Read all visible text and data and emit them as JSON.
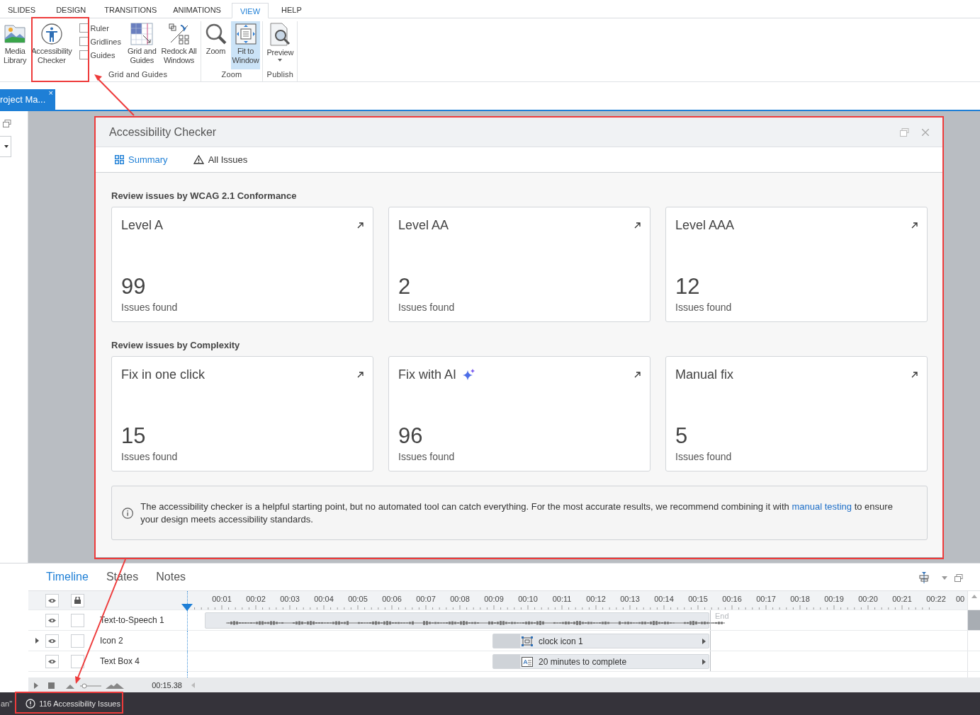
{
  "ribbon_tabs": [
    {
      "label": "SLIDES",
      "selected": false
    },
    {
      "label": "DESIGN",
      "selected": false
    },
    {
      "label": "TRANSITIONS",
      "selected": false
    },
    {
      "label": "ANIMATIONS",
      "selected": false
    },
    {
      "label": "VIEW",
      "selected": true
    },
    {
      "label": "HELP",
      "selected": false
    }
  ],
  "ribbon_groups": [
    {
      "items": [
        {
          "kind": "button",
          "label": "Media\nLibrary",
          "selected": false
        },
        {
          "kind": "button",
          "label": "Accessibility\nChecker",
          "selected": false
        }
      ]
    },
    {
      "label": "Grid and Guides",
      "items": [
        {
          "kind": "checks",
          "options": [
            {
              "label": "Ruler",
              "checked": false
            },
            {
              "label": "Gridlines",
              "checked": false
            },
            {
              "label": "Guides",
              "checked": false
            }
          ]
        },
        {
          "kind": "button",
          "label": "Grid and\nGuides",
          "selected": false
        },
        {
          "kind": "button",
          "label": "Redock All\nWindows",
          "selected": false
        }
      ]
    },
    {
      "label": "Zoom",
      "items": [
        {
          "kind": "button",
          "label": "Zoom",
          "selected": false
        },
        {
          "kind": "button",
          "label": "Fit to\nWindow",
          "selected": true
        }
      ]
    },
    {
      "label": "Publish",
      "items": [
        {
          "kind": "dropdown",
          "label": "Preview",
          "selected": false
        }
      ]
    }
  ],
  "document_tab": {
    "label": "roject Ma...",
    "close": "×"
  },
  "dialog": {
    "title": "Accessibility Checker",
    "tabs": [
      {
        "label": "Summary",
        "selected": true
      },
      {
        "label": "All Issues",
        "selected": false
      }
    ],
    "sections": [
      {
        "heading": "Review issues by WCAG 2.1 Conformance",
        "cards": [
          {
            "title": "Level A",
            "count": "99",
            "caption": "Issues found",
            "sparkle": false
          },
          {
            "title": "Level AA",
            "count": "2",
            "caption": "Issues found",
            "sparkle": false
          },
          {
            "title": "Level AAA",
            "count": "12",
            "caption": "Issues found",
            "sparkle": false
          }
        ]
      },
      {
        "heading": "Review issues by Complexity",
        "cards": [
          {
            "title": "Fix in one click",
            "count": "15",
            "caption": "Issues found",
            "sparkle": false
          },
          {
            "title": "Fix with AI",
            "count": "96",
            "caption": "Issues found",
            "sparkle": true
          },
          {
            "title": "Manual fix",
            "count": "5",
            "caption": "Issues found",
            "sparkle": false
          }
        ]
      }
    ],
    "notice": {
      "text_before": "The accessibility checker is a helpful starting point, but no automated tool can catch everything. For the most accurate results, we recommend combining it with",
      "link": "manual testing",
      "text_after": "to ensure your design meets accessibility standards."
    }
  },
  "timeline": {
    "tabs": [
      {
        "label": "Timeline",
        "selected": true
      },
      {
        "label": "States",
        "selected": false
      },
      {
        "label": "Notes",
        "selected": false
      }
    ],
    "ruler": [
      "00:01",
      "00:02",
      "00:03",
      "00:04",
      "00:05",
      "00:06",
      "00:07",
      "00:08",
      "00:09",
      "00:10",
      "00:11",
      "00:12",
      "00:13",
      "00:14",
      "00:15",
      "00:16",
      "00:17",
      "00:18",
      "00:19",
      "00:20",
      "00:21",
      "00:22",
      "00"
    ],
    "rows": [
      {
        "name": "Text-to-Speech 1",
        "expandable": false,
        "track": {
          "kind": "audio"
        }
      },
      {
        "name": "Icon 2",
        "expandable": true,
        "track": {
          "kind": "image",
          "label": "clock icon 1"
        }
      },
      {
        "name": "Text Box 4",
        "expandable": false,
        "track": {
          "kind": "text",
          "label": "20 minutes to complete"
        }
      }
    ],
    "end_label": "End",
    "time": "00:15.38"
  },
  "status_bar": {
    "left": "an\"",
    "issues": "116 Accessibility Issues"
  }
}
